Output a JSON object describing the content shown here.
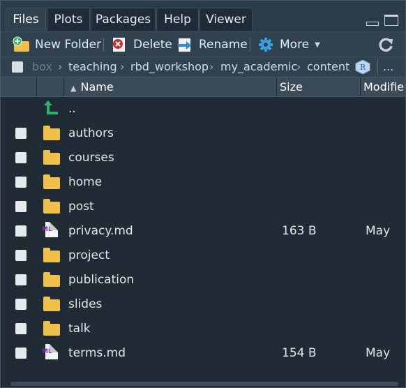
{
  "tabs": [
    {
      "label": "Files",
      "active": true
    },
    {
      "label": "Plots",
      "active": false
    },
    {
      "label": "Packages",
      "active": false
    },
    {
      "label": "Help",
      "active": false
    },
    {
      "label": "Viewer",
      "active": false
    }
  ],
  "toolbar": {
    "new_folder": "New Folder",
    "delete": "Delete",
    "rename": "Rename",
    "more": "More"
  },
  "breadcrumb": {
    "items": [
      "box",
      "teaching",
      "rbd_workshop",
      "my_academic",
      "content"
    ],
    "overflow": "..."
  },
  "table": {
    "columns": {
      "name": "Name",
      "size": "Size",
      "modified": "Modifie"
    },
    "parent": "..",
    "rows": [
      {
        "name": "authors",
        "type": "folder",
        "size": "",
        "modified": ""
      },
      {
        "name": "courses",
        "type": "folder",
        "size": "",
        "modified": ""
      },
      {
        "name": "home",
        "type": "folder",
        "size": "",
        "modified": ""
      },
      {
        "name": "post",
        "type": "folder",
        "size": "",
        "modified": ""
      },
      {
        "name": "privacy.md",
        "type": "md",
        "size": "163 B",
        "modified": "May"
      },
      {
        "name": "project",
        "type": "folder",
        "size": "",
        "modified": ""
      },
      {
        "name": "publication",
        "type": "folder",
        "size": "",
        "modified": ""
      },
      {
        "name": "slides",
        "type": "folder",
        "size": "",
        "modified": ""
      },
      {
        "name": "talk",
        "type": "folder",
        "size": "",
        "modified": ""
      },
      {
        "name": "terms.md",
        "type": "md",
        "size": "154 B",
        "modified": "May"
      }
    ]
  },
  "icons": {
    "md_label": "MD",
    "r_label": "R"
  },
  "colors": {
    "background": "#202b35",
    "toolbar": "#304250",
    "folder": "#efc04a",
    "parent_arrow": "#2fb36b"
  }
}
